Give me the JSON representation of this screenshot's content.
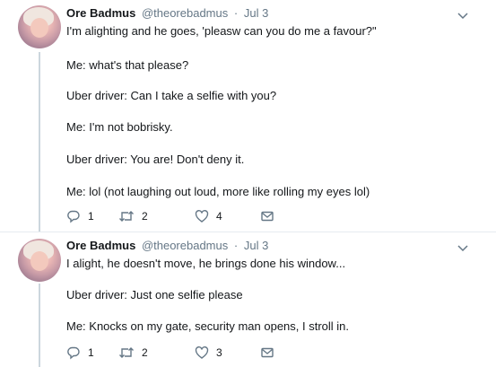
{
  "tweets": [
    {
      "name": "Ore Badmus",
      "handle": "@theorebadmus",
      "separator": "·",
      "time": "Jul 3",
      "lines": [
        "I'm alighting and he goes, 'pleasw can you do me a favour?\"",
        "Me: what's that please?",
        "Uber driver: Can I take a selfie with you?",
        "Me: I'm not bobrisky.",
        "Uber driver: You are! Don't deny it.",
        "Me: lol (not laughing out loud, more like rolling my eyes lol)"
      ],
      "reply_count": "1",
      "retweet_count": "2",
      "like_count": "4",
      "icons": [
        "reply-icon",
        "retweet-icon",
        "like-icon",
        "dm-icon",
        "chevron-down-icon"
      ]
    },
    {
      "name": "Ore Badmus",
      "handle": "@theorebadmus",
      "separator": "·",
      "time": "Jul 3",
      "lines": [
        "I alight, he doesn't move, he brings done his window...",
        "Uber driver: Just one selfie please",
        "Me: Knocks on my gate, security man opens, I stroll in."
      ],
      "reply_count": "1",
      "retweet_count": "2",
      "like_count": "3",
      "icons": [
        "reply-icon",
        "retweet-icon",
        "like-icon",
        "dm-icon",
        "chevron-down-icon"
      ]
    }
  ],
  "colors": {
    "text": "#14171a",
    "secondary": "#657786",
    "thread_line": "#ccd6dd",
    "divider": "#e6ecf0"
  }
}
